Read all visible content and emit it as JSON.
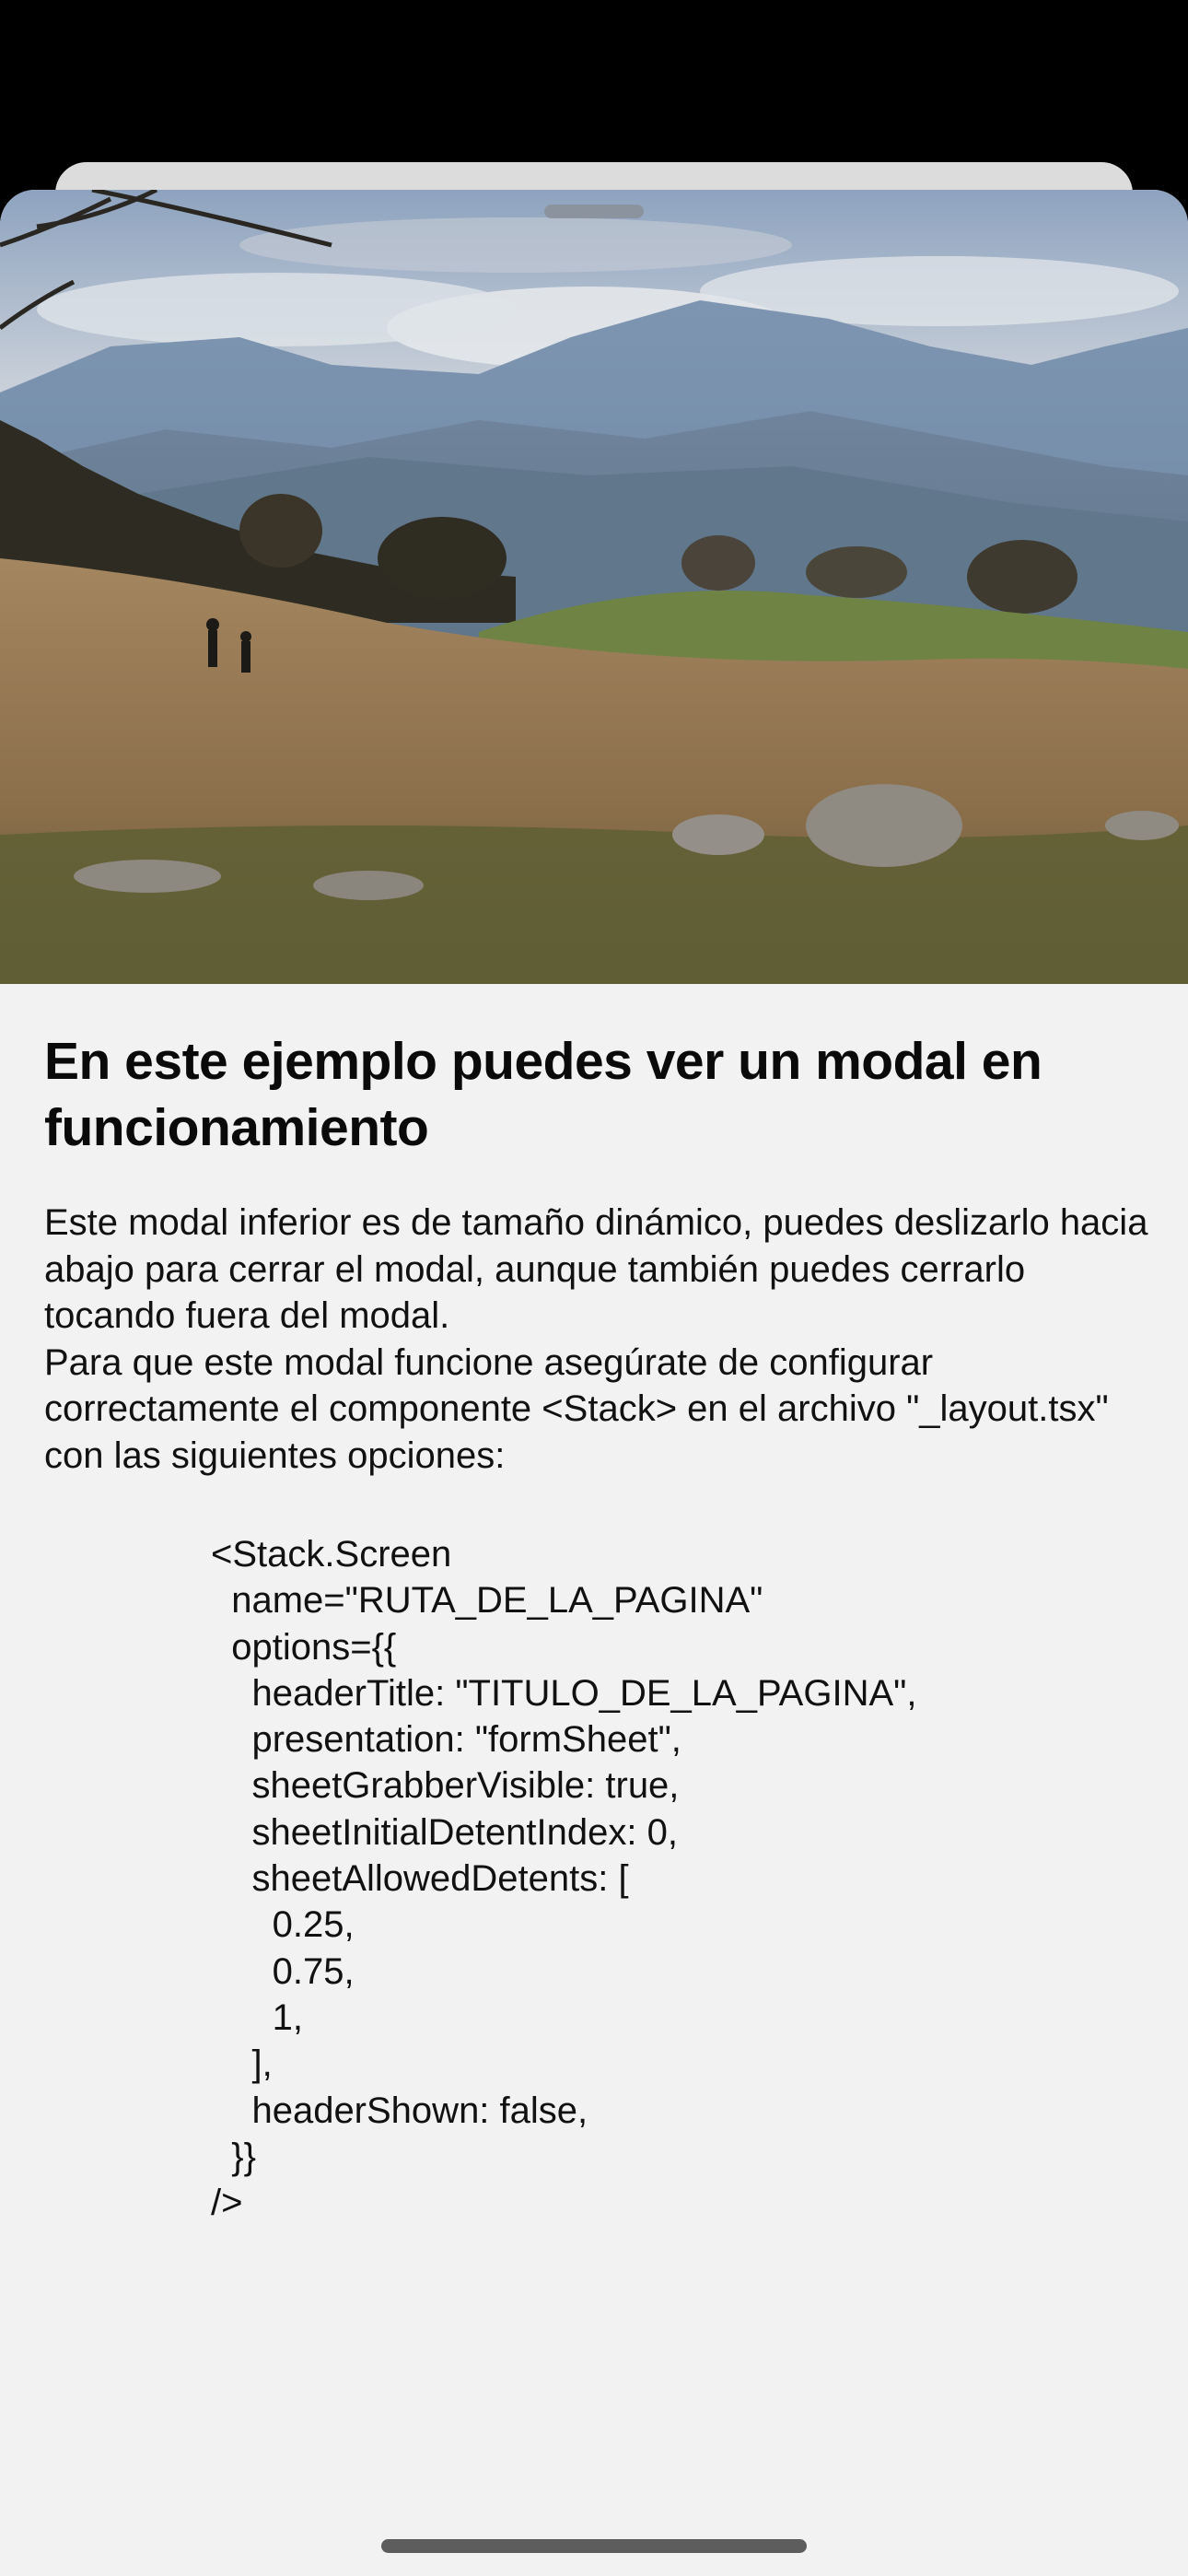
{
  "modal": {
    "title": "En este ejemplo puedes ver un modal en funcionamiento",
    "paragraphs": [
      "Este modal inferior es de tamaño dinámico, puedes deslizarlo hacia abajo para cerrar el modal, aunque también puedes cerrarlo tocando fuera del modal.",
      "Para que este modal funcione asegúrate de configurar correctamente el componente <Stack> en el archivo \"_layout.tsx\" con las siguientes opciones:"
    ],
    "code_lines": [
      "<Stack.Screen",
      "  name=\"RUTA_DE_LA_PAGINA\"",
      "  options={{",
      "    headerTitle: \"TITULO_DE_LA_PAGINA\",",
      "    presentation: \"formSheet\",",
      "    sheetGrabberVisible: true,",
      "    sheetInitialDetentIndex: 0,",
      "    sheetAllowedDetents: [",
      "      0.25,",
      "      0.75,",
      "      1,",
      "    ],",
      "    headerShown: false,",
      "  }}",
      "/>"
    ]
  },
  "icons": {
    "grabber": "sheet-grabber-handle",
    "home_indicator": "home-indicator-bar"
  },
  "colors": {
    "sheet_background": "#f2f2f2",
    "backdrop": "#000000",
    "text": "#111111"
  }
}
